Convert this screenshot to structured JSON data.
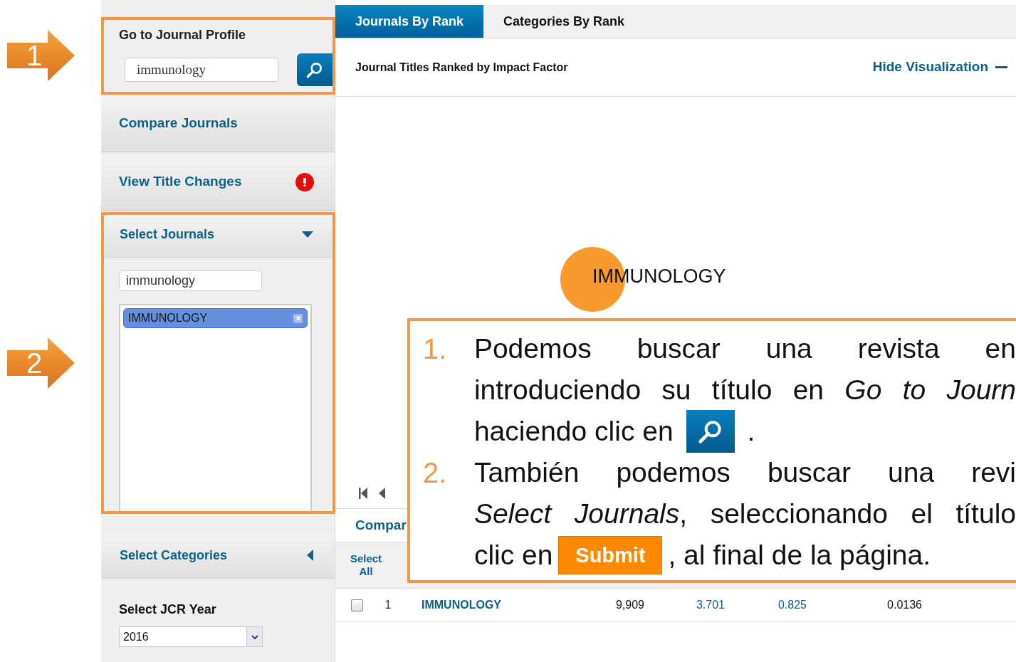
{
  "annotations": [
    {
      "label": "1"
    },
    {
      "label": "2"
    }
  ],
  "sidebar": {
    "journal_profile": {
      "title": "Go to Journal Profile",
      "search": {
        "value": "immunology"
      }
    },
    "items": [
      {
        "label": "Compare Journals",
        "alert": false
      },
      {
        "label": "View Title Changes",
        "alert": true
      }
    ],
    "select_journals": {
      "title": "Select Journals",
      "expanded": true,
      "filter": {
        "value": "immunology"
      },
      "chips": [
        {
          "label": "IMMUNOLOGY",
          "selected": true
        }
      ]
    },
    "select_categories": {
      "title": "Select Categories",
      "expanded": false
    },
    "jcr_year": {
      "label": "Select JCR Year",
      "value": "2016"
    }
  },
  "tabs": [
    {
      "label": "Journals By Rank",
      "selected": true
    },
    {
      "label": "Categories By Rank",
      "selected": false
    }
  ],
  "header": {
    "title": "Journal Titles Ranked by Impact Factor",
    "toggle": "Hide Visualization"
  },
  "visualization": {
    "bubble_label": "IMMUNOLOGY"
  },
  "table": {
    "tab_partial": "Compar",
    "select_all": "Select All",
    "rows": [
      {
        "checked": false,
        "cells": [
          "1",
          "IMMUNOLOGY",
          "9,909",
          "3.701",
          "0.825",
          "0.0136"
        ]
      }
    ]
  },
  "callout": {
    "items": [
      {
        "number": "1.",
        "lines": [
          {
            "parts": [
              {
                "kind": "text",
                "text": "Podemos buscar una revista en"
              }
            ]
          },
          {
            "parts": [
              {
                "kind": "text",
                "text": "introduciendo su título en *Go to Journ*"
              }
            ]
          },
          {
            "parts": [
              {
                "kind": "text",
                "text": "haciendo clic en"
              },
              {
                "kind": "search_button"
              },
              {
                "kind": "text",
                "text": "."
              }
            ]
          }
        ]
      },
      {
        "number": "2.",
        "lines": [
          {
            "parts": [
              {
                "kind": "text",
                "text": "También podemos buscar una revi"
              }
            ]
          },
          {
            "parts": [
              {
                "kind": "text",
                "text": "*Select Journals*, seleccionando el título"
              }
            ]
          },
          {
            "parts": [
              {
                "kind": "text",
                "text": "clic en"
              },
              {
                "kind": "submit_button",
                "text": "Submit"
              },
              {
                "kind": "text",
                "text": ", al final de la página."
              }
            ]
          }
        ]
      }
    ]
  }
}
